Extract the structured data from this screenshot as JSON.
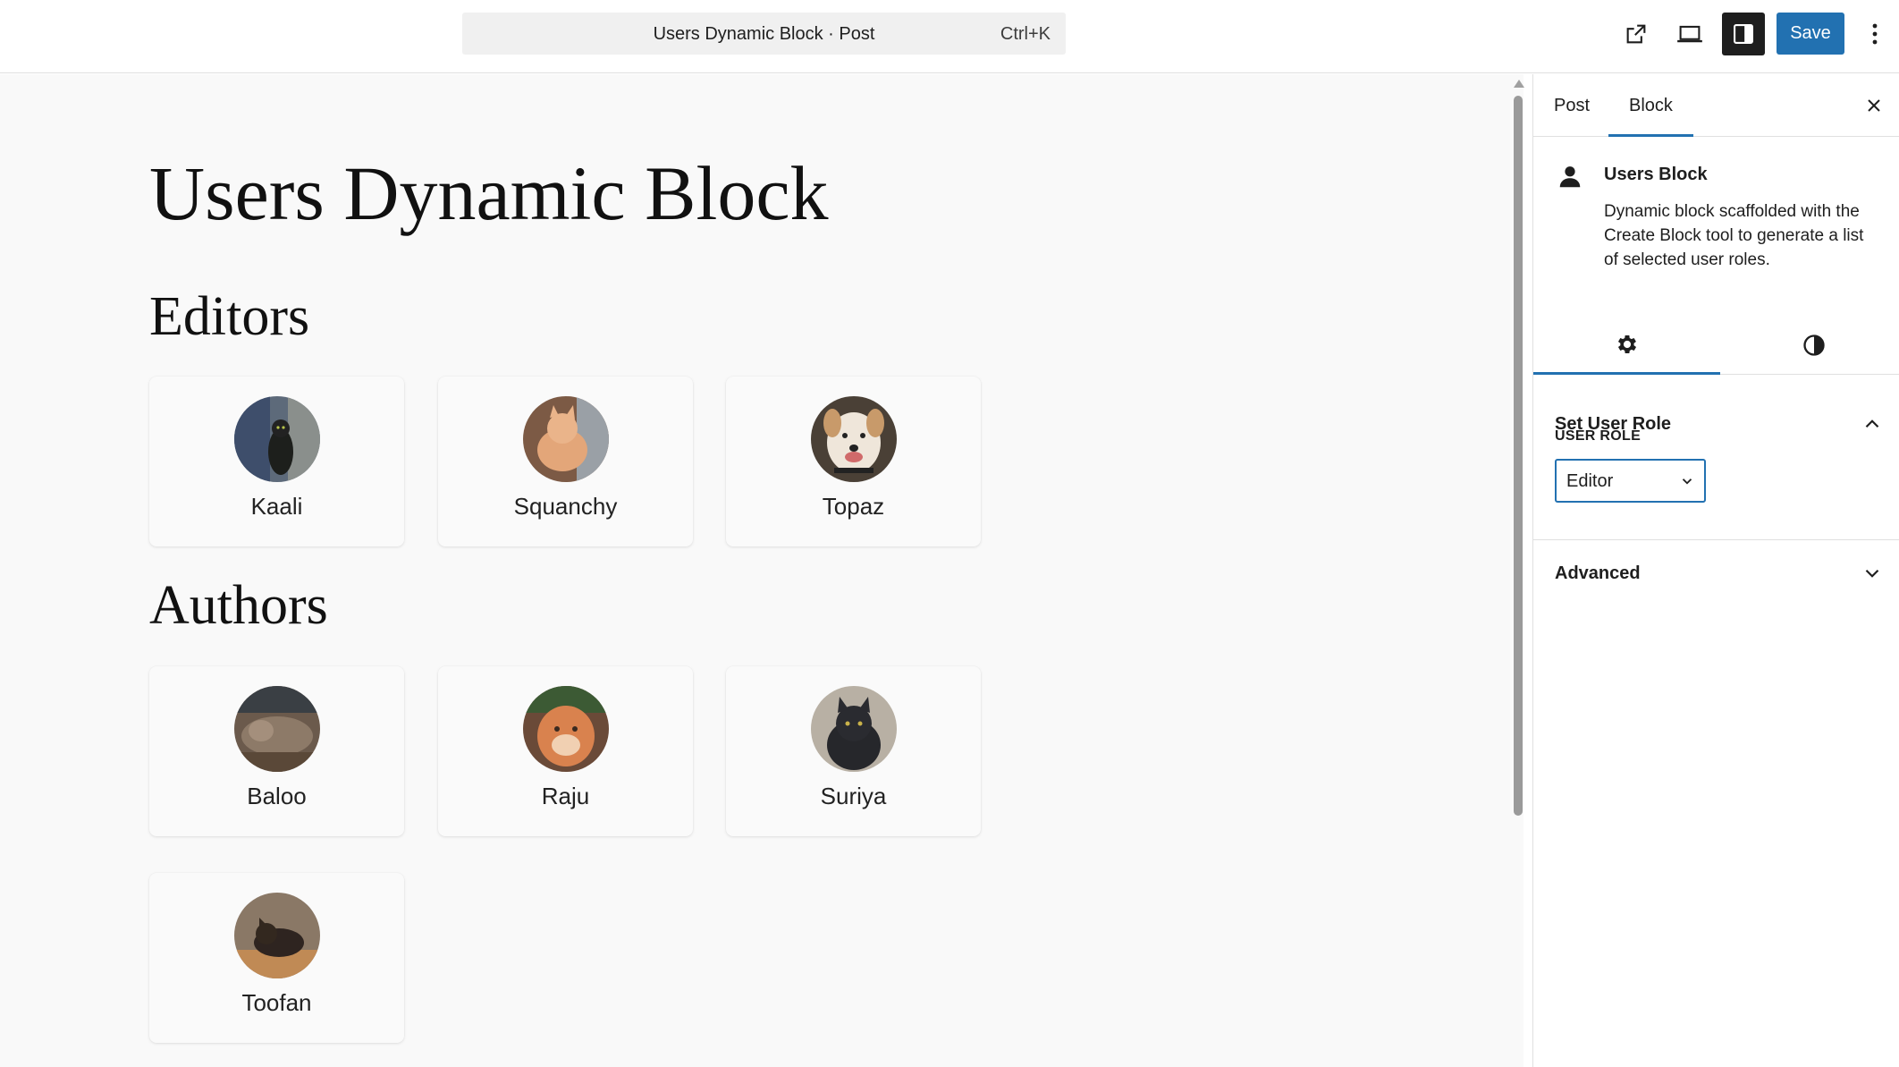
{
  "header": {
    "command_title": "Users Dynamic Block · Post",
    "command_shortcut": "Ctrl+K",
    "save_label": "Save",
    "icons": [
      "external-link-icon",
      "preview-icon",
      "settings-sidebar-icon",
      "more-options-icon"
    ]
  },
  "canvas": {
    "title": "Users Dynamic Block",
    "sections": [
      {
        "heading": "Editors",
        "users": [
          "Kaali",
          "Squanchy",
          "Topaz"
        ]
      },
      {
        "heading": "Authors",
        "users": [
          "Baloo",
          "Raju",
          "Suriya",
          "Toofan"
        ]
      }
    ]
  },
  "sidebar": {
    "tabs": [
      {
        "label": "Post",
        "active": false
      },
      {
        "label": "Block",
        "active": true
      }
    ],
    "block": {
      "title": "Users Block",
      "description": "Dynamic block scaffolded with the Create Block tool to generate a list of selected user roles.",
      "icon": "person-icon"
    },
    "sub_tabs": [
      "settings-gear-icon",
      "styles-contrast-icon"
    ],
    "panels": {
      "set_user_role": {
        "title": "Set User Role",
        "field_label": "USER ROLE",
        "selected": "Editor"
      },
      "advanced": {
        "title": "Advanced"
      }
    }
  },
  "colors": {
    "accent": "#2271b1",
    "canvas_bg": "#f9f9f9",
    "toolbar_dark": "#1e1e1e"
  }
}
